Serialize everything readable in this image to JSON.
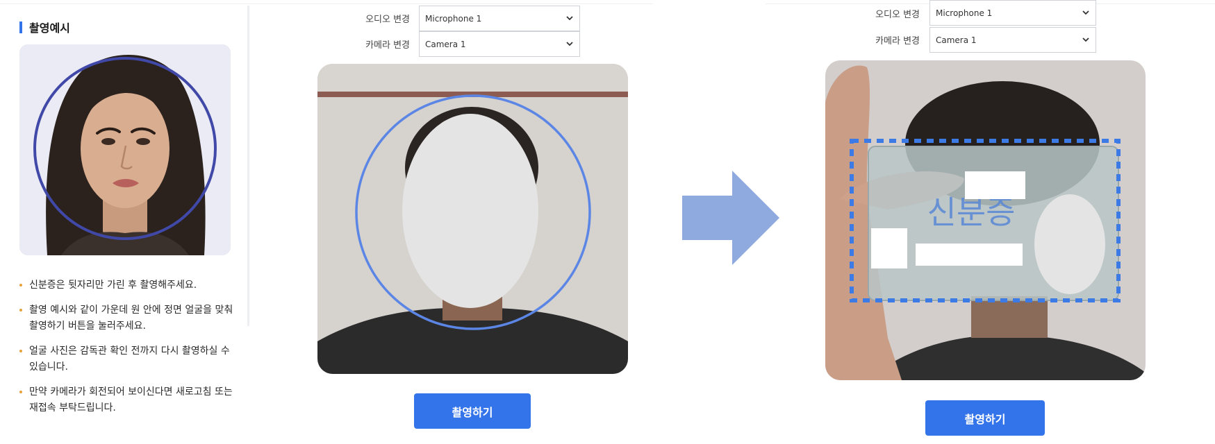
{
  "guide": {
    "title": "촬영예시",
    "notes": [
      "신분증은 뒷자리만 가린 후 촬영해주세요.",
      "촬영 예시와 같이 가운데 원 안에 정면 얼굴을 맞춰 촬영하기 버튼을 눌러주세요.",
      "얼굴 사진은 감독관 확인 전까지 다시 촬영하실 수 있습니다.",
      "만약 카메라가 회전되어 보이신다면 새로고침 또는 재접속 부탁드립니다."
    ]
  },
  "face_step": {
    "audio_label": "오디오 변경",
    "audio_value": "Microphone 1",
    "camera_label": "카메라 변경",
    "camera_value": "Camera 1",
    "capture_label": "촬영하기"
  },
  "id_step": {
    "audio_label": "오디오 변경",
    "audio_value": "Microphone 1",
    "camera_label": "카메라 변경",
    "camera_value": "Camera 1",
    "card_watermark": "신분증",
    "capture_label": "촬영하기"
  },
  "colors": {
    "accent": "#3474ea",
    "guide_circle": "#4048a8",
    "camera_circle": "#5b86e5",
    "arrow": "#8eaadf",
    "id_frame": "#3c7ae6"
  },
  "icons": {
    "select_chevron": "chevron-down-icon",
    "step_arrow": "arrow-right-icon"
  }
}
